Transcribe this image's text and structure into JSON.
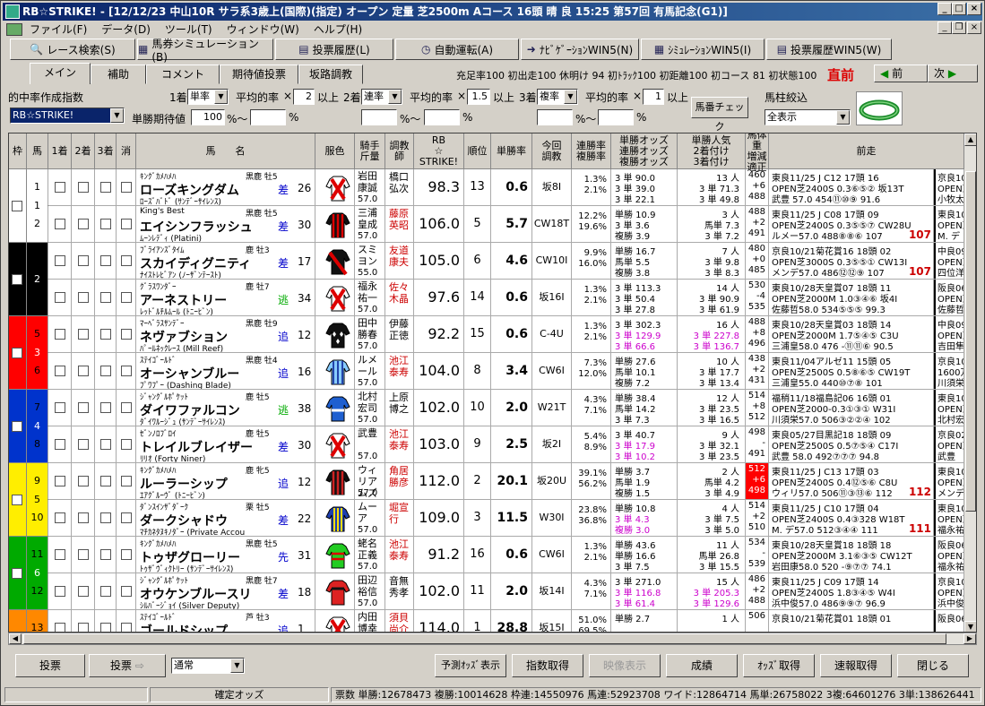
{
  "window": {
    "title": "RB☆STRIKE! - [12/12/23 中山10R サラ系3歳上(国際)(指定) オープン 定量 芝2500m Aコース 16頭 晴 良 15:25 第57回 有馬記念(G1)]"
  },
  "menu": [
    "ファイル(F)",
    "データ(D)",
    "ツール(T)",
    "ウィンドウ(W)",
    "ヘルプ(H)"
  ],
  "toolbar": [
    {
      "icon": "search-icon",
      "label": "レース検索(S)"
    },
    {
      "icon": "grid-icon",
      "label": "馬券シミュレーション(B)"
    },
    {
      "icon": "list-icon",
      "label": "投票履歴(L)"
    },
    {
      "icon": "clock-icon",
      "label": "自動運転(A)"
    },
    {
      "icon": "arrow-icon",
      "label": "ﾅﾋﾞｹﾞｰｼｮﾝWIN5(N)"
    },
    {
      "icon": "grid-icon",
      "label": "ｼﾐｭﾚｰｼｮﾝWIN5(I)"
    },
    {
      "icon": "list-icon",
      "label": "投票履歴WIN5(W)"
    }
  ],
  "tabs": [
    "メイン",
    "補助",
    "コメント",
    "期待値投票",
    "坂路調教"
  ],
  "stats": "充足率100 初出走100 休明け 94 初ﾄﾗｯｸ100 初距離100 初コース 81 初状態100",
  "nav": {
    "immediate": "直前",
    "prev": "前",
    "next": "次"
  },
  "filters": {
    "title": "的中率作成指数",
    "index_value": "RB☆STRIKE!",
    "first_label": "1着",
    "first_type": "単率",
    "avg1_label": "平均的率",
    "x1": "×",
    "v1": "2",
    "ijou1": "以上",
    "second_label": "2着",
    "second_type": "連率",
    "avg2_label": "平均的率",
    "x2": "×",
    "v2": "1.5",
    "ijou2": "以上",
    "third_label": "3着",
    "third_type": "複率",
    "avg3_label": "平均的率",
    "x3": "×",
    "v3": "1",
    "ijou3": "以上",
    "tankyo_label": "単勝期待値",
    "tankyo_val": "100",
    "pct": "%",
    "tilde": "%〜",
    "check_button": "馬番チェック",
    "filter_label": "馬柱絞込",
    "filter_value": "全表示"
  },
  "headers": [
    "枠",
    "馬",
    "1着",
    "2着",
    "3着",
    "消",
    "馬　　名",
    "服色",
    "騎手\n斤量",
    "調教\n師",
    "RB\n☆\nSTRIKE!",
    "順位",
    "単勝率",
    "今回\n調教",
    "連勝率\n複勝率",
    "単勝オッズ\n連勝オッズ\n複勝オッズ",
    "単勝人気\n2着付け\n3着付け",
    "馬体重\n増減\n適正",
    "前走"
  ],
  "horses": [
    {
      "num": "1",
      "sire": "ｷﾝｸﾞｶﾒﾊﾒﾊ",
      "sexage": "黒鹿 牡5",
      "name": "ローズキングダム",
      "dam": "ﾛｰｽﾞﾊﾞﾄﾞ (ｻﾝﾃﾞｰｻｲﾚﾝｽ)",
      "style": "差",
      "age2": "26",
      "jockey": "岩田康誠",
      "weight": "57.0",
      "trainer": "橋口弘次",
      "trainer_red": false,
      "rb": "98.3",
      "rank": "13",
      "tan": "0.6",
      "train": "坂8I",
      "ren": "1.3%",
      "fuku": "2.1%",
      "odds": [
        "3 単 90.0",
        "3 単 39.0",
        "3 単 22.1"
      ],
      "pop": [
        "13 人",
        "3 単 71.3",
        "3 単 49.8"
      ],
      "bw": [
        "460",
        "+6",
        "488"
      ],
      "prev": [
        "東良11/25 J C12 17頭 16",
        "OPEN芝2400S 0.3⑥⑤② 坂13T",
        "武豊 57.0 454⑪⑩⑨ 91.6"
      ],
      "prev_hl": "",
      "extra": [
        "京良10",
        "OPEN芝",
        "小牧太"
      ],
      "silk": "x"
    },
    {
      "num": "2",
      "sire": "King's Best",
      "sexage": "黒鹿 牡5",
      "name": "エイシンフラッシュ",
      "dam": "ﾑｰﾝﾚﾃﾞｨ (Platini)",
      "style": "差",
      "age2": "30",
      "jockey": "三浦皇成",
      "weight": "57.0",
      "trainer": "藤原英昭",
      "trainer_red": true,
      "rb": "106.0",
      "rank": "5",
      "tan": "5.7",
      "train": "CW18T",
      "ren": "12.2%",
      "fuku": "19.6%",
      "odds": [
        "単勝 10.9",
        "3 単 3.6",
        "複勝 3.9"
      ],
      "pop": [
        "3 人",
        "馬単 7.3",
        "3 単 7.2"
      ],
      "bw": [
        "488",
        "+2",
        "491"
      ],
      "prev": [
        "東良11/25 J C08 17頭 09",
        "OPEN芝2400S 0.3⑤⑤⑦ CW28U",
        "ルメー57.0 488⑧⑧⑥ 107"
      ],
      "prev_hl": "107",
      "extra": [
        "東良10",
        "OPEN芝",
        "M. デ"
      ],
      "silk": "stripe"
    },
    {
      "num": "3",
      "sire": "ﾌﾞﾗｲｱﾝｽﾞﾀｲﾑ",
      "sexage": "鹿 牡3",
      "name": "スカイディグニティ",
      "dam": "ﾅｲｽﾄﾚﾋﾞｱﾝ (ﾉｰｻﾞﾝﾃｰｽﾄ)",
      "style": "差",
      "age2": "17",
      "jockey": "スミヨン",
      "weight": "55.0",
      "trainer": "友道康夫",
      "trainer_red": true,
      "rb": "105.0",
      "rank": "6",
      "tan": "4.6",
      "train": "CW10I",
      "ren": "9.9%",
      "fuku": "16.0%",
      "odds": [
        "単勝 16.7",
        "馬単 5.5",
        "複勝 3.8"
      ],
      "pop": [
        "7 人",
        "3 単 9.8",
        "3 単 8.3"
      ],
      "bw": [
        "480",
        "+0",
        "485"
      ],
      "prev": [
        "京良10/21菊花賞16 18頭 02",
        "OPEN芝3000S 0.3⑤⑤① CW13I",
        "メンデ57.0 486⑫⑫⑨ 107"
      ],
      "prev_hl": "107",
      "extra": [
        "中良09",
        "OPEN芝",
        "四位洋"
      ],
      "silk": "sash"
    },
    {
      "num": "4",
      "sire": "ｸﾞﾗｽﾜﾝﾀﾞｰ",
      "sexage": "鹿 牡7",
      "name": "アーネストリー",
      "dam": "ﾚｯﾄﾞﾙﾁﾙﾑｰﾙ (ﾄﾆｰﾋﾞﾝ)",
      "style": "逃",
      "age2": "34",
      "jockey": "福永祐一",
      "weight": "57.0",
      "trainer": "佐々木晶",
      "trainer_red": true,
      "rb": "97.6",
      "rank": "14",
      "tan": "0.6",
      "train": "坂16I",
      "ren": "1.3%",
      "fuku": "2.1%",
      "odds": [
        "3 単 113.3",
        "3 単 50.4",
        "3 単 27.8"
      ],
      "pop": [
        "14 人",
        "3 単 90.9",
        "3 単 61.9"
      ],
      "bw": [
        "530",
        "-4",
        "535"
      ],
      "prev": [
        "東良10/28天皇賞07 18頭 11",
        "OPEN芝2000M 1.0③④⑥ 坂4I",
        "佐藤哲58.0 534⑤⑤⑤ 99.3"
      ],
      "prev_hl": "",
      "extra": [
        "阪良06",
        "OPEN芝",
        "佐藤哲"
      ],
      "silk": "x"
    },
    {
      "num": "5",
      "sire": "ﾏｰﾍﾞﾗｽｻﾝﾃﾞｰ",
      "sexage": "黒鹿 牡9",
      "name": "ネヴァブション",
      "dam": "ﾊﾟｰﾙﾈｯｸﾚｰｽ (Mill Reef)",
      "style": "追",
      "age2": "12",
      "jockey": "田中勝春",
      "weight": "57.0",
      "trainer": "伊藤正徳",
      "trainer_red": false,
      "rb": "92.2",
      "rank": "15",
      "tan": "0.6",
      "train": "C-4U",
      "ren": "1.3%",
      "fuku": "2.1%",
      "odds": [
        "3 単 302.3",
        "3 単 129.9",
        "3 単 66.6"
      ],
      "pop": [
        "16 人",
        "3 単 227.8",
        "3 単 136.7"
      ],
      "bw": [
        "488",
        "+8",
        "496"
      ],
      "prev": [
        "東良10/28天皇賞03 18頭 14",
        "OPEN芝2000M 1.7⑤④⑤ C3U",
        "三浦皇58.0 476 -⑪⑪⑥ 90.5"
      ],
      "prev_hl": "",
      "extra": [
        "中良09",
        "OPEN芝",
        "吉田隼"
      ],
      "silk": "dia"
    },
    {
      "num": "6",
      "sire": "ｽﾃｲｺﾞｰﾙﾄﾞ",
      "sexage": "黒鹿 牡4",
      "name": "オーシャンブルー",
      "dam": "ﾌﾟﾜﾌﾟｰ (Dashing Blade)",
      "style": "追",
      "age2": "16",
      "jockey": "ルメール",
      "weight": "57.0",
      "trainer": "池江泰寿",
      "trainer_red": true,
      "rb": "104.0",
      "rank": "8",
      "tan": "3.4",
      "train": "CW6I",
      "ren": "7.3%",
      "fuku": "12.0%",
      "odds": [
        "単勝 27.6",
        "馬単 10.1",
        "複勝 7.2"
      ],
      "pop": [
        "10 人",
        "3 単 17.7",
        "3 単 13.4"
      ],
      "bw": [
        "438",
        "+2",
        "431"
      ],
      "prev": [
        "東良11/04アルゼ11 15頭 05",
        "OPEN芝2500S 0.5⑧⑥⑤ CW19T",
        "三浦皇55.0 440⑩⑦⑧ 101"
      ],
      "prev_hl": "",
      "extra": [
        "京良10",
        "1600万",
        "川須栄"
      ],
      "silk": "bluestripe"
    },
    {
      "num": "7",
      "sire": "ｼﾞｬﾝｸﾞﾙﾎﾟｹｯﾄ",
      "sexage": "鹿 牡5",
      "name": "ダイワファルコン",
      "dam": "ﾀﾞｲﾜﾙｰｼﾞｭ (ｻﾝﾃﾞｰｻｲﾚﾝｽ)",
      "style": "逃",
      "age2": "38",
      "jockey": "北村宏司",
      "weight": "57.0",
      "trainer": "上原博之",
      "trainer_red": false,
      "rb": "102.0",
      "rank": "10",
      "tan": "2.0",
      "train": "W21T",
      "ren": "4.3%",
      "fuku": "7.1%",
      "odds": [
        "単勝 38.4",
        "馬単 14.2",
        "3 単 7.3"
      ],
      "pop": [
        "12 人",
        "3 単 23.5",
        "3 単 16.5"
      ],
      "bw": [
        "514",
        "+8",
        "512"
      ],
      "prev": [
        "福稍11/18福島記06 16頭 01",
        "OPEN芝2000-0.3①③① W31I",
        "川須栄57.0 506③②②④ 102"
      ],
      "prev_hl": "",
      "extra": [
        "東良10",
        "OPEN芝",
        "北村宏"
      ],
      "silk": "blue"
    },
    {
      "num": "8",
      "sire": "ｾﾞﾝﾉﾛﾌﾞﾛｲ",
      "sexage": "鹿 牡5",
      "name": "トレイルブレイザー",
      "dam": "ﾘﾘｵ (Forty Niner)",
      "style": "差",
      "age2": "30",
      "jockey": "武豊",
      "weight": "57.0",
      "trainer": "池江泰寿",
      "trainer_red": true,
      "rb": "103.0",
      "rank": "9",
      "tan": "2.5",
      "train": "坂2I",
      "ren": "5.4%",
      "fuku": "8.9%",
      "odds": [
        "3 単 40.7",
        "3 単 17.9",
        "3 単 10.2"
      ],
      "pop": [
        "9 人",
        "3 単 32.1",
        "3 単 23.5"
      ],
      "bw": [
        "498",
        "-",
        "491"
      ],
      "prev": [
        "東良05/27目黒記18 18頭 09",
        "OPEN芝2500S 0.5⑦⑤④ C17I",
        "武豊 58.0 492⑦⑦⑦ 94.8"
      ],
      "prev_hl": "",
      "extra": [
        "京良02",
        "OPEN芝",
        "武豊"
      ],
      "silk": "x"
    },
    {
      "num": "9",
      "sire": "ｷﾝｸﾞｶﾒﾊﾒﾊ",
      "sexage": "鹿 牝5",
      "name": "ルーラーシップ",
      "dam": "ｴｱｸﾞﾙｰｳﾞ (ﾄﾆｰﾋﾞﾝ)",
      "style": "追",
      "age2": "12",
      "jockey": "ウィリアムズ",
      "weight": "57.0",
      "trainer": "角居勝彦",
      "trainer_red": true,
      "rb": "112.0",
      "rank": "2",
      "tan": "20.1",
      "train": "坂20U",
      "ren": "39.1%",
      "fuku": "56.2%",
      "odds": [
        "単勝 3.7",
        "馬単 1.9",
        "複勝 1.5"
      ],
      "pop": [
        "2 人",
        "馬単 4.2",
        "3 単 4.9"
      ],
      "bw": [
        "512",
        "+6",
        "498"
      ],
      "bw_red": true,
      "prev": [
        "東良11/25 J C13 17頭 03",
        "OPEN芝2400S 0.4⑫⑤⑥ C8U",
        "ウィリ57.0 506⑪③⑬⑥ 112"
      ],
      "prev_hl": "112",
      "extra": [
        "東良10",
        "OPEN芝",
        "メンデ"
      ],
      "silk": "stripe2"
    },
    {
      "num": "10",
      "sire": "ﾀﾞﾝｽｲﾝｻﾞﾀﾞｰｸ",
      "sexage": "栗 牡5",
      "name": "ダークシャドウ",
      "dam": "ﾏﾁｶﾈﾀﾇｷﾉﾀﾞｰ (Private Accou",
      "style": "差",
      "age2": "22",
      "jockey": "ムーア",
      "weight": "57.0",
      "trainer": "堀宣行",
      "trainer_red": true,
      "rb": "109.0",
      "rank": "3",
      "tan": "11.5",
      "train": "W30I",
      "ren": "23.8%",
      "fuku": "36.8%",
      "odds": [
        "単勝 10.8",
        "3 単 4.3",
        "複勝 3.0"
      ],
      "pop": [
        "4 人",
        "3 単 7.5",
        "3 単 5.0"
      ],
      "bw": [
        "514",
        "+2",
        "510"
      ],
      "prev": [
        "東良11/25 J C10 17頭 04",
        "OPEN芝2400S 0.4③328 W18T",
        "M. デ57.0 512③④④ 111"
      ],
      "prev_hl": "111",
      "extra": [
        "東良10",
        "OPEN芝",
        "福永祐"
      ],
      "silk": "yellowstripe"
    },
    {
      "num": "11",
      "sire": "ｷﾝｸﾞｶﾒﾊﾒﾊ",
      "sexage": "黒鹿 牡5",
      "name": "トゥザグローリー",
      "dam": "ﾄｩｻﾞｳﾞｨｸﾄﾘｰ (ｻﾝﾃﾞｰｻｲﾚﾝｽ)",
      "style": "先",
      "age2": "31",
      "jockey": "蛯名正義",
      "weight": "57.0",
      "trainer": "池江泰寿",
      "trainer_red": true,
      "rb": "91.2",
      "rank": "16",
      "tan": "0.6",
      "train": "CW6I",
      "ren": "1.3%",
      "fuku": "2.1%",
      "odds": [
        "単勝 43.6",
        "単勝 16.6",
        "3 単 7.5"
      ],
      "pop": [
        "11 人",
        "馬単 26.8",
        "3 単 15.5"
      ],
      "bw": [
        "534",
        "-",
        "539"
      ],
      "prev": [
        "東良10/28天皇賞18 18頭 18",
        "OPEN芝2000M 3.1⑥③⑤ CW12T",
        "岩田康58.0 520 -⑨⑦⑦ 74.1"
      ],
      "prev_hl": "",
      "extra": [
        "阪良06",
        "OPEN芝",
        "福永祐"
      ],
      "silk": "green"
    },
    {
      "num": "12",
      "sire": "ｼﾞｬﾝｸﾞﾙﾎﾟｹｯﾄ",
      "sexage": "黒鹿 牡7",
      "name": "オウケンブルースリ",
      "dam": "ｼﾙﾊﾞｰｼﾞｮｲ (Silver Deputy)",
      "style": "差",
      "age2": "18",
      "jockey": "田辺裕信",
      "weight": "57.0",
      "trainer": "音無秀孝",
      "trainer_red": false,
      "rb": "102.0",
      "rank": "11",
      "tan": "2.0",
      "train": "坂14I",
      "ren": "4.3%",
      "fuku": "7.1%",
      "odds": [
        "3 単 271.0",
        "3 単 116.8",
        "3 単 61.4"
      ],
      "pop": [
        "15 人",
        "3 単 205.3",
        "3 単 129.6"
      ],
      "bw": [
        "486",
        "+2",
        "488"
      ],
      "prev": [
        "東良11/25 J C09 17頭 14",
        "OPEN芝2400S 1.8③④⑤ W4I",
        "浜中俊57.0 486⑨⑨⑦ 96.9"
      ],
      "prev_hl": "",
      "extra": [
        "京良10",
        "OPEN芝",
        "浜中俊"
      ],
      "silk": "red"
    },
    {
      "num": "13",
      "sire": "ｽﾃｲｺﾞｰﾙﾄﾞ",
      "sexage": "芦 牡3",
      "name": "ゴールドシップ",
      "dam": "",
      "style": "追",
      "age2": "1",
      "jockey": "内田博幸",
      "weight": "55.0",
      "trainer": "須貝尚介",
      "trainer_red": true,
      "rb": "114.0",
      "rank": "1",
      "tan": "28.8",
      "train": "坂15I",
      "ren": "51.0%",
      "fuku": "69.5%",
      "odds": [
        "単勝 2.7",
        "",
        ""
      ],
      "pop": [
        "1 人",
        "",
        ""
      ],
      "bw": [
        "506",
        "",
        ""
      ],
      "prev": [
        "京良10/21菊花賞01 18頭 01",
        "",
        ""
      ],
      "prev_hl": "",
      "extra": [
        "阪良06",
        "",
        ""
      ],
      "silk": "x"
    }
  ],
  "wakus": [
    {
      "num": "1",
      "color": "#ffffff"
    },
    {
      "num": "2",
      "color": "#000000"
    },
    {
      "num": "3",
      "color": "#ff0000"
    },
    {
      "num": "4",
      "color": "#0033cc"
    },
    {
      "num": "5",
      "color": "#ffee00"
    },
    {
      "num": "6",
      "color": "#00aa00"
    },
    {
      "num": "7",
      "color": "#ff8800"
    }
  ],
  "bottom": [
    "投票",
    "投票",
    "通常",
    "予測ｵｯｽﾞ表示",
    "指数取得",
    "映像表示",
    "成績",
    "ｵｯｽﾞ取得",
    "速報取得",
    "閉じる"
  ],
  "status": [
    "確定オッズ",
    "票数",
    "単勝:12678473",
    "複勝:10014628",
    "枠連:14550976",
    "馬連:52923708",
    "ワイド:12864714",
    "馬単:26758022",
    "3複:64601276",
    "3単:138626441"
  ]
}
